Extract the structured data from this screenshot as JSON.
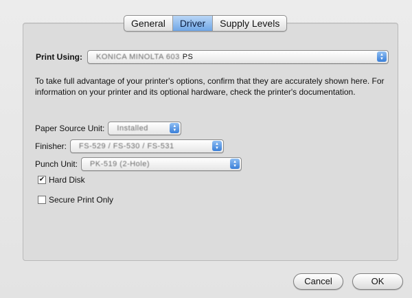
{
  "tabs": {
    "general": "General",
    "driver": "Driver",
    "supply_levels": "Supply Levels"
  },
  "print_using": {
    "label": "Print Using:",
    "value_blurred": "KONICA MINOLTA 603",
    "value_suffix": "PS"
  },
  "description": "To take full advantage of your printer's options, confirm that they are accurately shown here. For information on your printer and its optional hardware, check the printer's documentation.",
  "options": {
    "paper_source": {
      "label": "Paper Source Unit:",
      "value": "Installed"
    },
    "finisher": {
      "label": "Finisher:",
      "value": "FS-529 / FS-530 / FS-531"
    },
    "punch_unit": {
      "label": "Punch Unit:",
      "value": "PK-519 (2-Hole)"
    },
    "hard_disk": {
      "label": "Hard Disk",
      "checked": true
    },
    "secure_print": {
      "label": "Secure Print Only",
      "checked": false
    }
  },
  "buttons": {
    "cancel": "Cancel",
    "ok": "OK"
  }
}
